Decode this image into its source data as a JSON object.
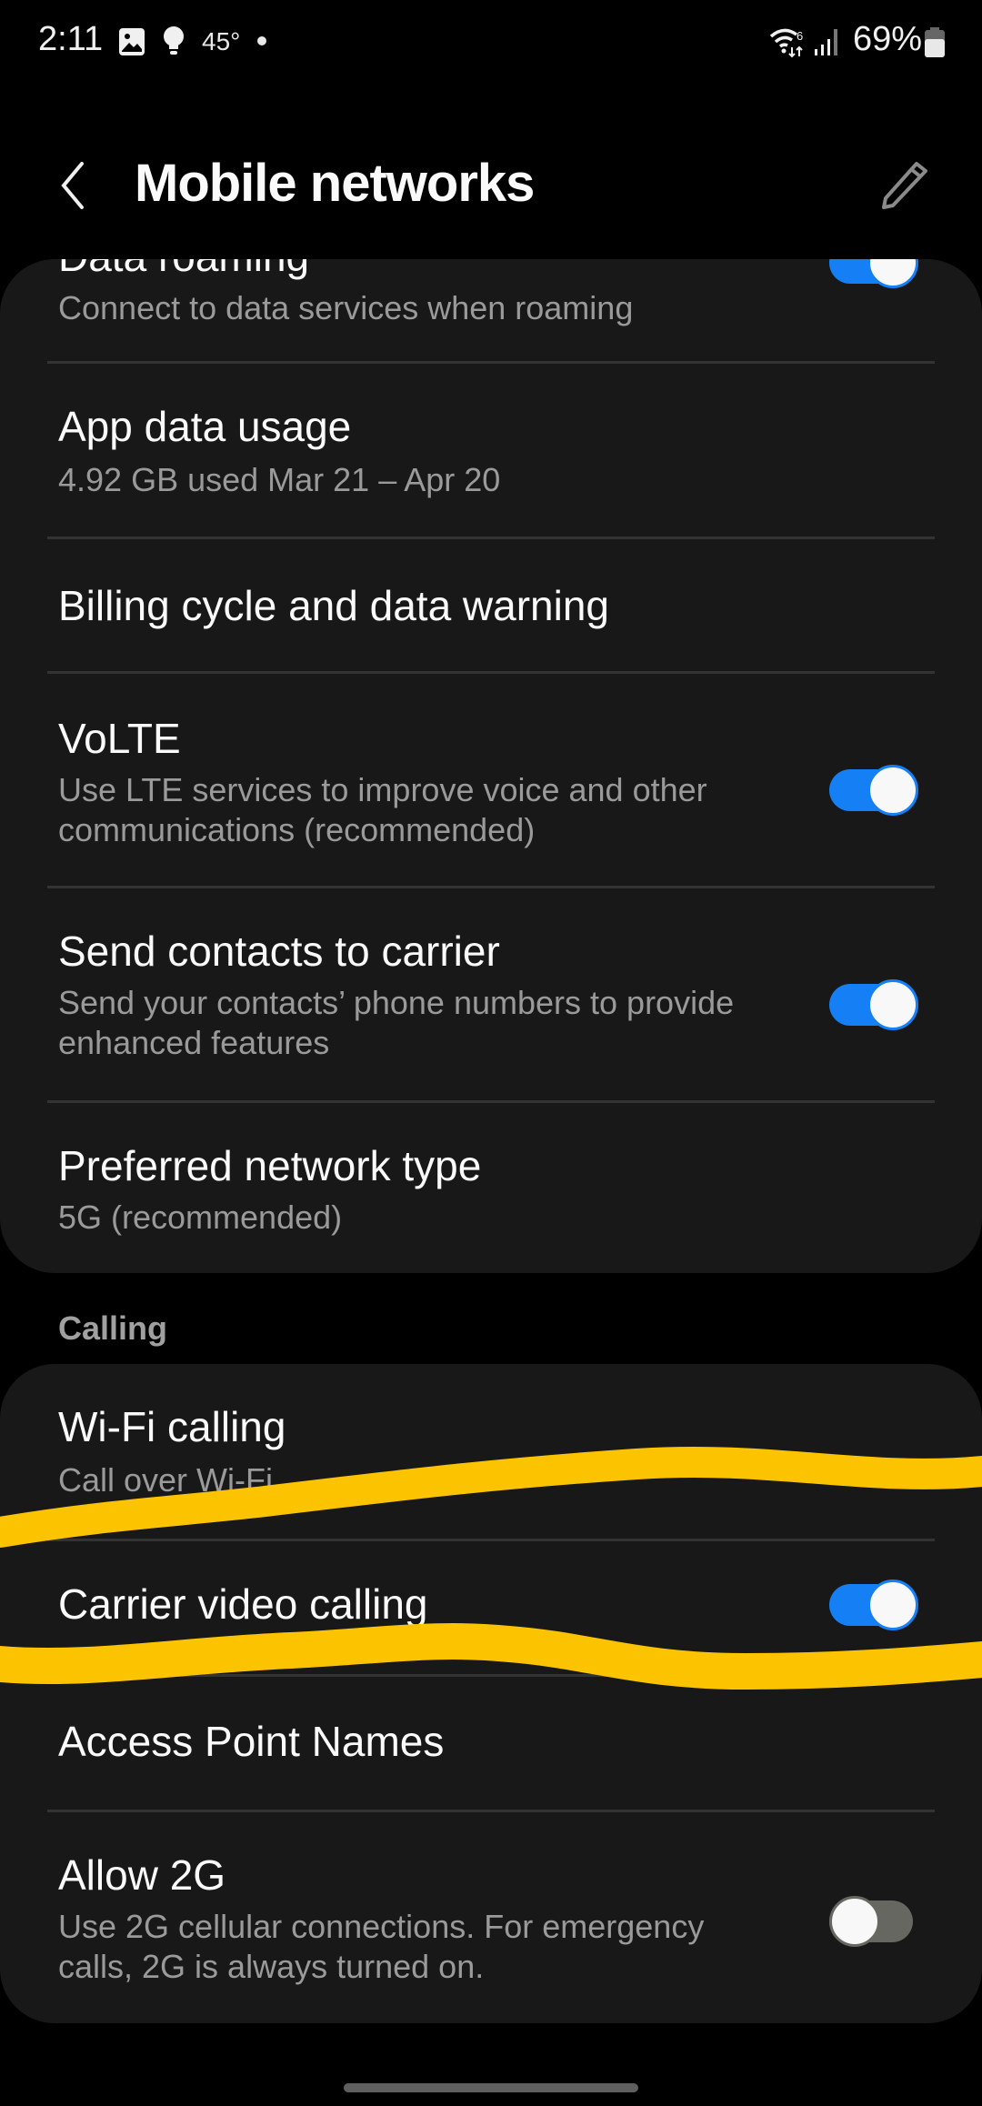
{
  "status_bar": {
    "time": "2:11",
    "temperature": "45°",
    "battery_percent": "69%",
    "icons": [
      "gallery-icon",
      "bulb-icon",
      "wifi-6-icon",
      "signal-icon",
      "battery-icon"
    ]
  },
  "header": {
    "title": "Mobile networks",
    "back_icon": "chevron-left-icon",
    "edit_icon": "pencil-icon"
  },
  "settings": [
    {
      "title": "Data roaming",
      "subtitle": "Connect to data services when roaming",
      "toggle": true
    },
    {
      "title": "App data usage",
      "subtitle": "4.92 GB used Mar 21 – Apr 20"
    },
    {
      "title": "Billing cycle and data warning"
    },
    {
      "title": "VoLTE",
      "subtitle": "Use LTE services to improve voice and other communications (recommended)",
      "toggle": true
    },
    {
      "title": "Send contacts to carrier",
      "subtitle": "Send your contacts’ phone numbers to provide enhanced features",
      "toggle": true
    },
    {
      "title": "Preferred network type",
      "subtitle": "5G (recommended)"
    }
  ],
  "calling_section": {
    "label": "Calling",
    "items": [
      {
        "title": "Wi-Fi calling",
        "subtitle": "Call over Wi-Fi"
      },
      {
        "title": "Carrier video calling",
        "toggle": true
      },
      {
        "title": "Access Point Names"
      },
      {
        "title": "Allow 2G",
        "subtitle": "Use 2G cellular connections. For emergency calls, 2G is always turned on.",
        "toggle": false
      }
    ]
  },
  "colors": {
    "accent": "#1580f5",
    "highlight_marker": "#fcc400",
    "card_bg": "#181818",
    "toggle_off": "#676762"
  }
}
